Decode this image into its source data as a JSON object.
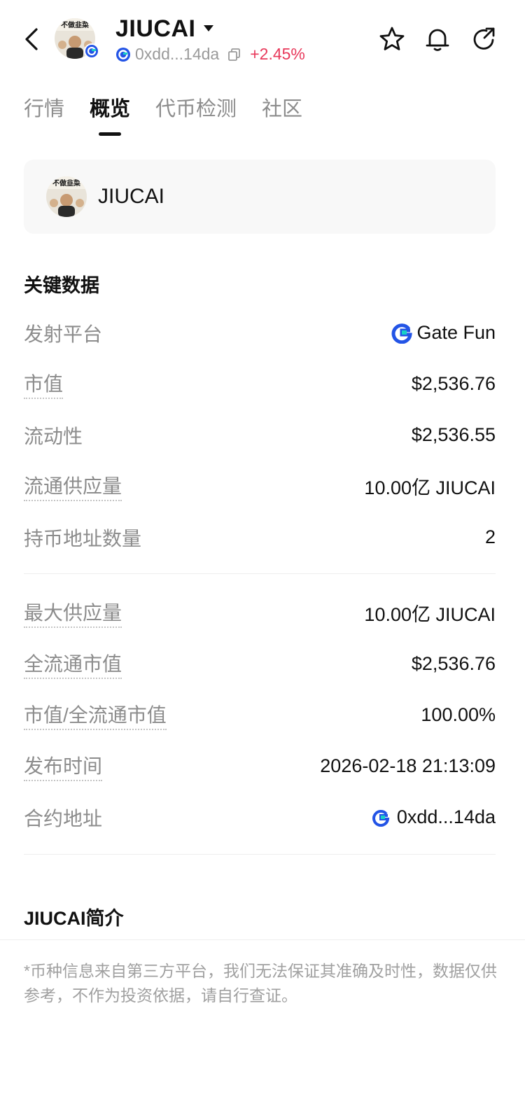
{
  "header": {
    "token_name": "JIUCAI",
    "address_short": "0xdd...14da",
    "change": "+2.45%",
    "avatar_text": "不做韭菜"
  },
  "tabs": [
    {
      "label": "行情",
      "active": false
    },
    {
      "label": "概览",
      "active": true
    },
    {
      "label": "代币检测",
      "active": false
    },
    {
      "label": "社区",
      "active": false
    }
  ],
  "token_card": {
    "name": "JIUCAI"
  },
  "key_data": {
    "title": "关键数据",
    "rows_a": [
      {
        "label": "发射平台",
        "value": "Gate Fun"
      },
      {
        "label": "市值",
        "value": "$2,536.76"
      },
      {
        "label": "流动性",
        "value": "$2,536.55"
      },
      {
        "label": "流通供应量",
        "value": "10.00亿 JIUCAI"
      },
      {
        "label": "持币地址数量",
        "value": "2"
      }
    ],
    "rows_b": [
      {
        "label": "最大供应量",
        "value": "10.00亿 JIUCAI"
      },
      {
        "label": "全流通市值",
        "value": "$2,536.76"
      },
      {
        "label": "市值/全流通市值",
        "value": "100.00%"
      },
      {
        "label": "发布时间",
        "value": "2026-02-18 21:13:09"
      },
      {
        "label": "合约地址",
        "value": "0xdd...14da"
      }
    ]
  },
  "intro": {
    "title": "JIUCAI简介",
    "disclaimer": "*币种信息来自第三方平台，我们无法保证其准确及时性，数据仅供参考，不作为投资依据，请自行查证。"
  },
  "colors": {
    "change_red": "#e8385a",
    "gate_blue": "#2354e6",
    "gate_cyan": "#17d1c5",
    "muted_text": "#8c8c8c"
  },
  "icons": [
    "back-icon",
    "caret-down-icon",
    "chain-icon",
    "copy-icon",
    "star-icon",
    "bell-icon",
    "share-icon",
    "gate-fun-icon"
  ]
}
